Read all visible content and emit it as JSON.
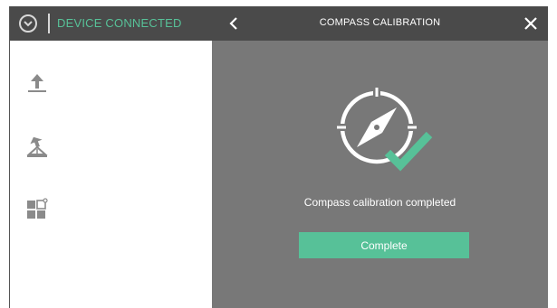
{
  "sidebar": {
    "device_status": "DEVICE CONNECTED",
    "tools": [
      {
        "icon": "upload-icon"
      },
      {
        "icon": "return-home-icon"
      },
      {
        "icon": "grid-settings-icon"
      }
    ]
  },
  "dialog": {
    "title": "COMPASS CALIBRATION",
    "back_icon": "chevron-left-icon",
    "close_icon": "close-icon",
    "graphic_icon": "compass-check-icon",
    "message": "Compass calibration completed",
    "complete_label": "Complete"
  },
  "colors": {
    "accent": "#57c198",
    "header": "#4a4a4a",
    "dialog_bg": "#787878"
  }
}
